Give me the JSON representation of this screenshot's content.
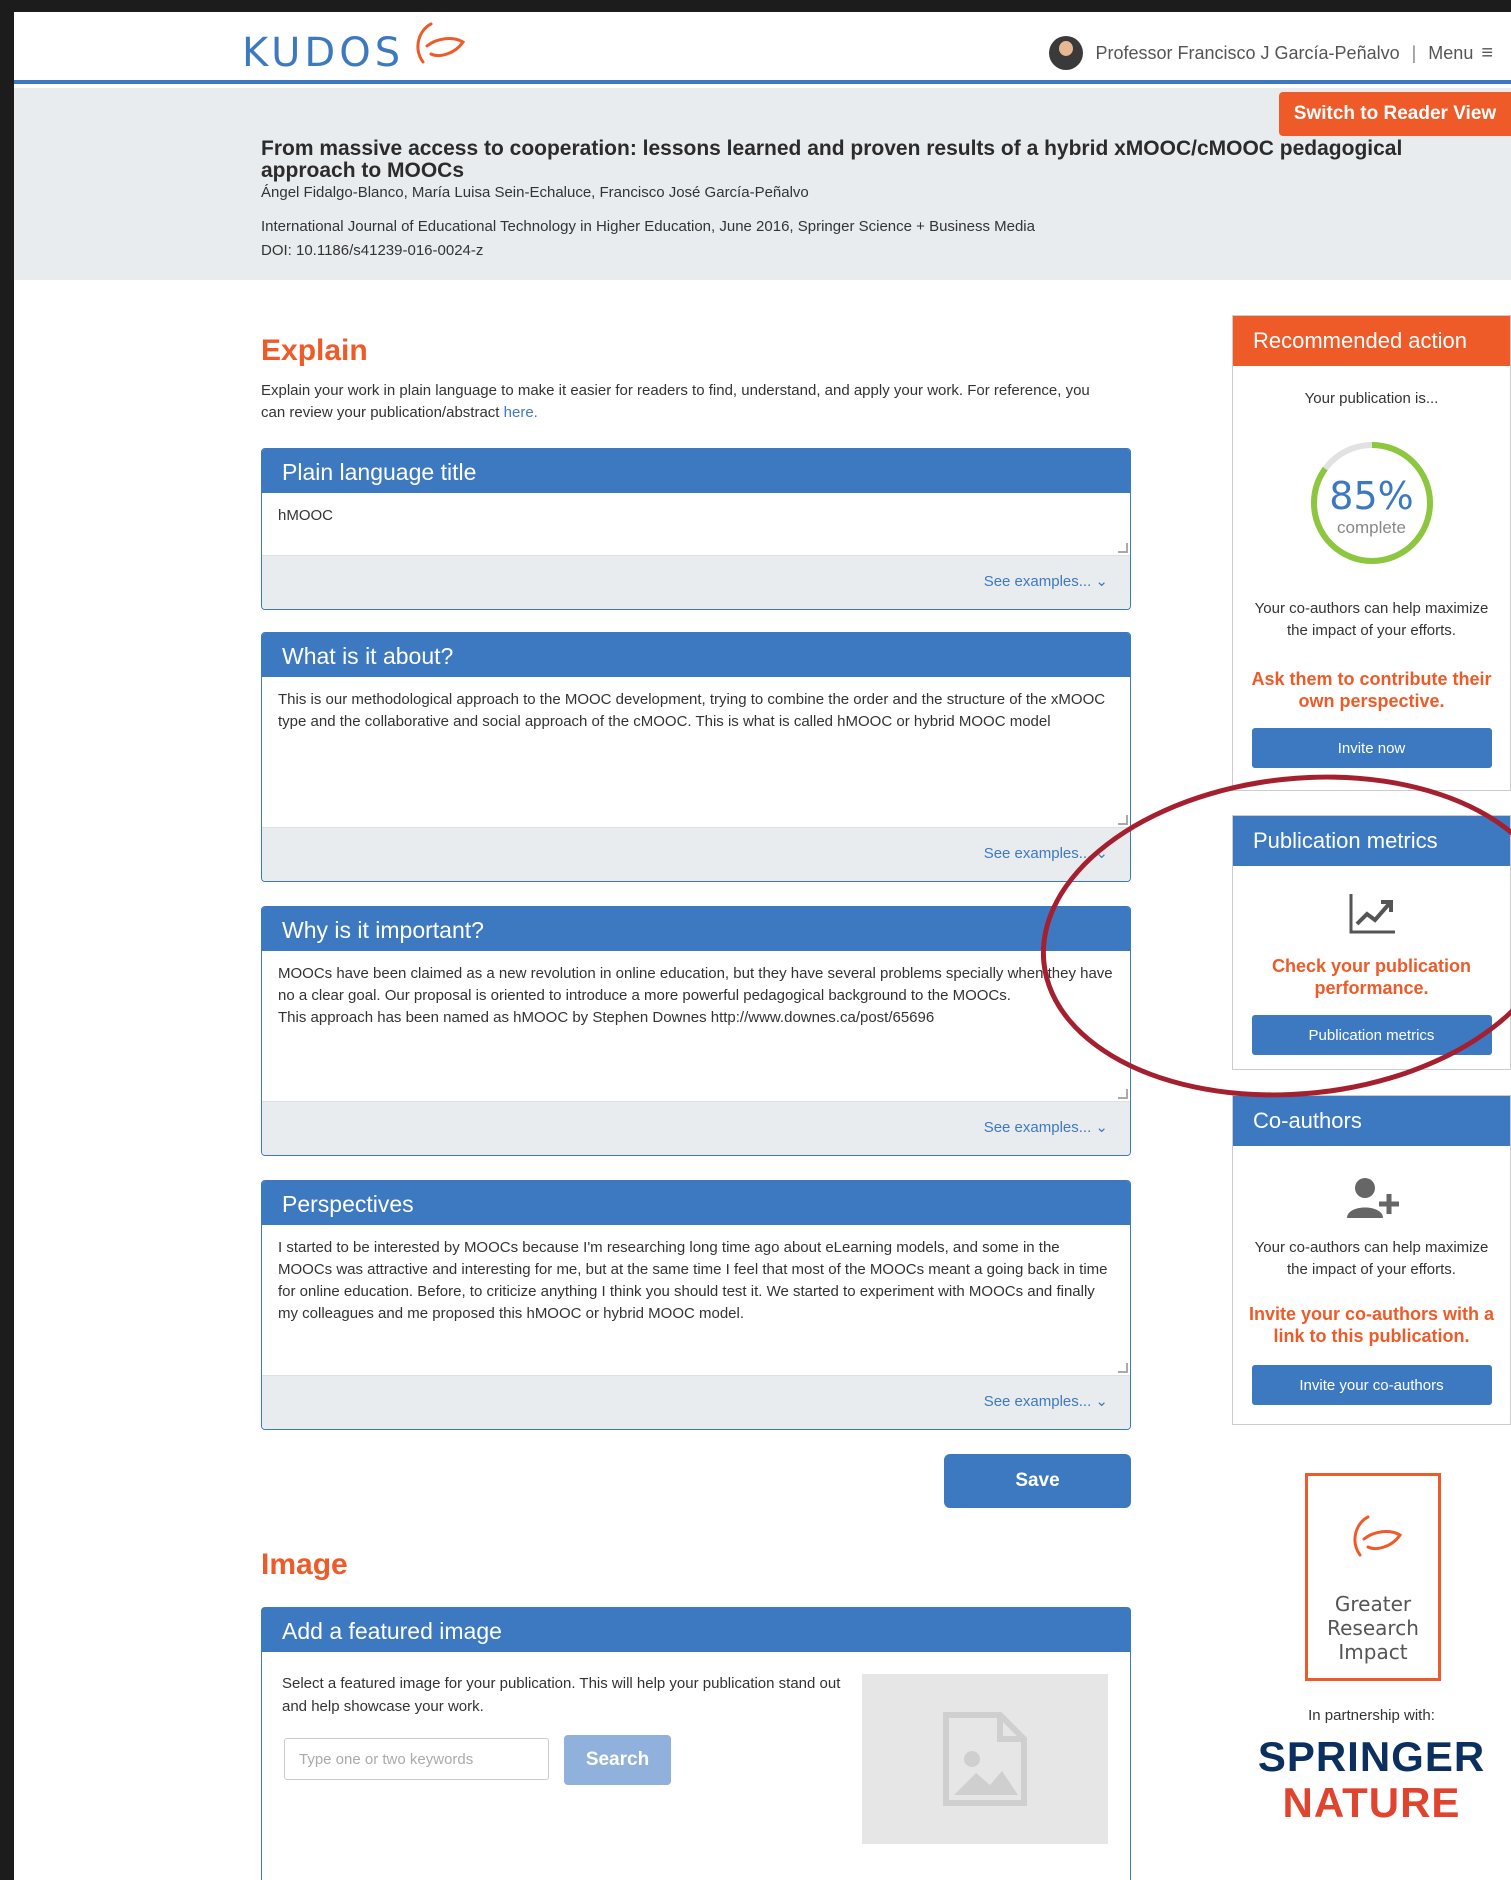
{
  "header": {
    "logo": "KUDOS",
    "user_name": "Professor Francisco J García-Peñalvo",
    "menu_label": "Menu"
  },
  "publication": {
    "reader_view_label": "Switch to Reader View",
    "title": "From massive access to cooperation: lessons learned and proven results of a hybrid xMOOC/cMOOC pedagogical approach to MOOCs",
    "authors": "Ángel Fidalgo-Blanco, María Luisa Sein-Echaluce, Francisco José García-Peñalvo",
    "journal": "International Journal of Educational Technology in Higher Education, June 2016, Springer Science + Business Media",
    "doi": "DOI: 10.1186/s41239-016-0024-z"
  },
  "explain": {
    "heading": "Explain",
    "intro": "Explain your work in plain language to make it easier for readers to find, understand, and apply your work. For reference, you can review your publication/abstract",
    "intro_link": "here.",
    "see_examples": "See examples... ⌄",
    "cards": [
      {
        "title": "Plain language title",
        "text": "hMOOC"
      },
      {
        "title": "What is it about?",
        "text": "This is our methodological approach to the MOOC development, trying to combine the order and the structure of the xMOOC type and the collaborative and social approach of the cMOOC. This is what is called hMOOC or hybrid MOOC model"
      },
      {
        "title": "Why is it important?",
        "text": "MOOCs have been claimed as a new revolution in online education, but they have several problems specially when they have no a clear goal. Our proposal is oriented to introduce a more powerful pedagogical background to the MOOCs.",
        "text2": "This approach has been named as hMOOC by Stephen Downes http://www.downes.ca/post/65696"
      },
      {
        "title": "Perspectives",
        "text": "I started to be interested by MOOCs because I'm researching long time ago about eLearning models, and some in the MOOCs was attractive and interesting for me, but at the same time I feel that most of the MOOCs meant a going back in time for online education. Before, to criticize anything I think you should test it. We started to experiment with MOOCs and finally my colleagues and me proposed this hMOOC or hybrid MOOC model."
      }
    ],
    "save_label": "Save"
  },
  "image": {
    "heading": "Image",
    "card_title": "Add a featured image",
    "description": "Select a featured image for your publication. This will help your publication stand out and help showcase your work.",
    "keyword_placeholder": "Type one or two keywords",
    "search_label": "Search"
  },
  "sidebar": {
    "recommended": {
      "title": "Recommended action",
      "status": "Your publication is...",
      "percent": 85,
      "percent_label": "85%",
      "complete_label": "complete",
      "help_text": "Your co-authors can help maximize the impact of your efforts.",
      "cta": "Ask them to contribute their own perspective.",
      "button": "Invite now"
    },
    "metrics": {
      "title": "Publication metrics",
      "cta": "Check your publication performance.",
      "button": "Publication metrics"
    },
    "coauthors": {
      "title": "Co-authors",
      "help_text": "Your co-authors can help maximize the impact of your efforts.",
      "cta": "Invite your co-authors with a link to this publication.",
      "button": "Invite your co-authors"
    },
    "badge_text": "Greater Research Impact",
    "partnership": "In partnership with:",
    "partner_line1": "SPRINGER",
    "partner_line2": "NATURE"
  },
  "colors": {
    "accent_blue": "#3d79c1",
    "accent_orange": "#ee5b29",
    "progress_green": "#8dc63f",
    "annotation_red": "#a4202f"
  }
}
